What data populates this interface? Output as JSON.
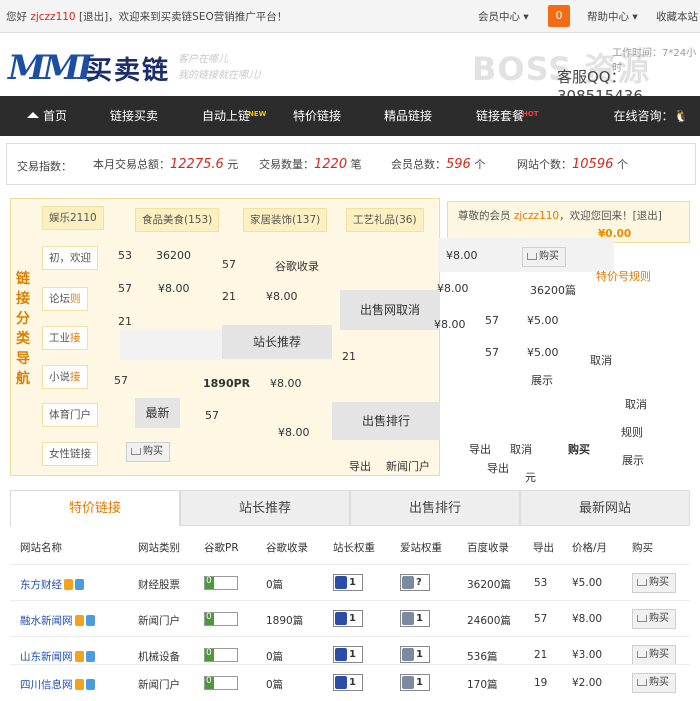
{
  "topbar": {
    "greeting": "您好",
    "username": "zjczz110",
    "logout": "[退出]",
    "welcome": "，欢迎来到买卖链SEO营销推广平台！",
    "member_center": "会员中心",
    "notif_count": "0",
    "help_center": "帮助中心",
    "bookmark": "收藏本站"
  },
  "header": {
    "logo_latin": "MML",
    "logo_cn": "买卖链",
    "slogan1": "客户在哪儿",
    "slogan2": "我的链接就在哪儿!",
    "watermark": "BOSS 资源",
    "work_time": "工作时间：7*24小时",
    "hotline": "客服QQ：308515436"
  },
  "nav": {
    "items": [
      "首页",
      "链接买卖",
      "自动上链",
      "特价链接",
      "精品链接",
      "链接套餐"
    ],
    "badge_auto": "NEW",
    "badge_pkg": "HOT",
    "consult": "在线咨询："
  },
  "stats": {
    "label": "交易指数：",
    "monthly_label": "本月交易总额：",
    "monthly_value": "12275.6",
    "monthly_unit": "元",
    "count_label": "交易数量：",
    "count_value": "1220",
    "count_unit": "笔",
    "members_label": "会员总数：",
    "members_value": "596",
    "members_unit": "个",
    "sites_label": "网站个数：",
    "sites_value": "10596",
    "sites_unit": "个"
  },
  "catnav": {
    "title": "链接分类导航",
    "cats": [
      "娱乐2110",
      "食品美食(153)",
      "家居装饰(137)",
      "工艺礼品(36)",
      "初，欢迎",
      "论坛",
      "工业",
      "小说",
      "体育门户",
      "女性链接"
    ],
    "cat_suffix": [
      "",
      "",
      "",
      "",
      "",
      "则",
      "接",
      "接",
      "",
      ""
    ]
  },
  "account": {
    "line1_a": "尊敬的会员",
    "line1_user": "zjczz110",
    "line1_b": "，欢迎您回来！[退出]",
    "balance": "¥0.00"
  },
  "glitch": {
    "t1": "53",
    "t2": "36200",
    "t3": "57",
    "t4": "谷歌收录",
    "t5": "57",
    "t6": "¥8.00",
    "t7": "21",
    "t8": "¥8.00",
    "t9": "21",
    "t10": "站长推荐",
    "t11": "出售网取消",
    "t12": "¥8.00",
    "t13": "36200篇",
    "t14": "¥8.00",
    "t15": "57",
    "t16": "¥5.00",
    "t17": "21",
    "t18": "57",
    "t19": "¥5.00",
    "t20": "57",
    "t21": "1890PR",
    "t22": "¥8.00",
    "t23": "最新",
    "t24": "57",
    "t25": "出售排行",
    "t26": "¥8.00",
    "t27": "导出",
    "t28": "新闻门户",
    "t29": "导出",
    "t30": "取消",
    "t31": "购买",
    "t32": "元",
    "t33": "特价号规则",
    "t34": "取消",
    "t35": "展示",
    "t36": "取消",
    "t37": "规则",
    "t38": "展示",
    "t39": "导出",
    "t40": "¥8.00"
  },
  "buy_label": "购买",
  "tabs": [
    "特价链接",
    "站长推荐",
    "出售排行",
    "最新网站"
  ],
  "table": {
    "headers": [
      "网站名称",
      "网站类别",
      "谷歌PR",
      "谷歌收录",
      "站长权重",
      "爱站权重",
      "百度收录",
      "导出",
      "价格/月",
      "购买"
    ],
    "rows": [
      {
        "name": "东方财经",
        "category": "财经股票",
        "pr": "0",
        "google": "0篇",
        "zz": "1",
        "az": "?",
        "baidu": "36200篇",
        "out": "53",
        "price": "¥5.00",
        "buy": "购买"
      },
      {
        "name": "融水新闻网",
        "category": "新闻门户",
        "pr": "0",
        "google": "1890篇",
        "zz": "1",
        "az": "1",
        "baidu": "24600篇",
        "out": "57",
        "price": "¥8.00",
        "buy": "购买"
      },
      {
        "name": "山东新闻网",
        "category": "机械设备",
        "pr": "0",
        "google": "0篇",
        "zz": "1",
        "az": "1",
        "baidu": "536篇",
        "out": "21",
        "price": "¥3.00",
        "buy": "购买"
      },
      {
        "name": "四川信息网",
        "category": "新闻门户",
        "pr": "0",
        "google": "0篇",
        "zz": "1",
        "az": "1",
        "baidu": "170篇",
        "out": "19",
        "price": "¥2.00",
        "buy": "购买"
      }
    ]
  },
  "colors": {
    "accent": "#e17b00",
    "nav_bg": "#2c2c2c",
    "brand_blue": "#1b4fa3",
    "highlight_red": "#d4281a"
  }
}
